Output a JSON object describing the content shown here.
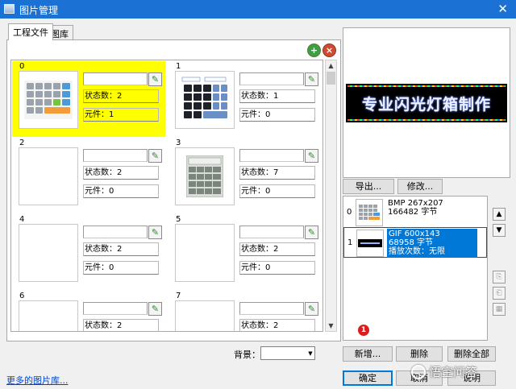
{
  "window": {
    "title": "图片管理",
    "close_glyph": "✕"
  },
  "tabs": [
    {
      "label": "工程文件",
      "active": true
    },
    {
      "label": "图库",
      "active": false
    }
  ],
  "cells": [
    {
      "index": "0",
      "state_label": "状态数：2",
      "element_label": "元件：1",
      "thumb": "keypad-color",
      "selected": true
    },
    {
      "index": "1",
      "state_label": "状态数：1",
      "element_label": "元件：0",
      "thumb": "keypad-dark",
      "selected": false
    },
    {
      "index": "2",
      "state_label": "状态数：2",
      "element_label": "元件：0",
      "thumb": "none",
      "selected": false
    },
    {
      "index": "3",
      "state_label": "状态数：7",
      "element_label": "元件：0",
      "thumb": "keypad-grey",
      "selected": false
    },
    {
      "index": "4",
      "state_label": "状态数：2",
      "element_label": "元件：0",
      "thumb": "none",
      "selected": false
    },
    {
      "index": "5",
      "state_label": "状态数：2",
      "element_label": "元件：0",
      "thumb": "none",
      "selected": false
    },
    {
      "index": "6",
      "state_label": "状态数：2",
      "element_label": "",
      "thumb": "none",
      "selected": false
    },
    {
      "index": "7",
      "state_label": "状态数：2",
      "element_label": "",
      "thumb": "none",
      "selected": false
    }
  ],
  "background": {
    "label": "背景："
  },
  "more_link": "更多的图片库...",
  "preview": {
    "banner_text": "专业闪光灯箱制作"
  },
  "preview_buttons": {
    "export": "导出...",
    "modify": "修改..."
  },
  "frames": [
    {
      "index": "0",
      "line1": "BMP 267x207",
      "line2": "166482 字节",
      "line3": "",
      "selected": false
    },
    {
      "index": "1",
      "line1": "GIF 600x143",
      "line2": "68958 字节",
      "line3": "播放次数：无限",
      "selected": true
    }
  ],
  "badge": "1",
  "bottom_buttons": {
    "add": "新增...",
    "delete": "删除",
    "delete_all": "删除全部"
  },
  "dialog_buttons": {
    "ok": "确定",
    "cancel": "取消",
    "help": "说明"
  },
  "watermark": "悟空问答"
}
